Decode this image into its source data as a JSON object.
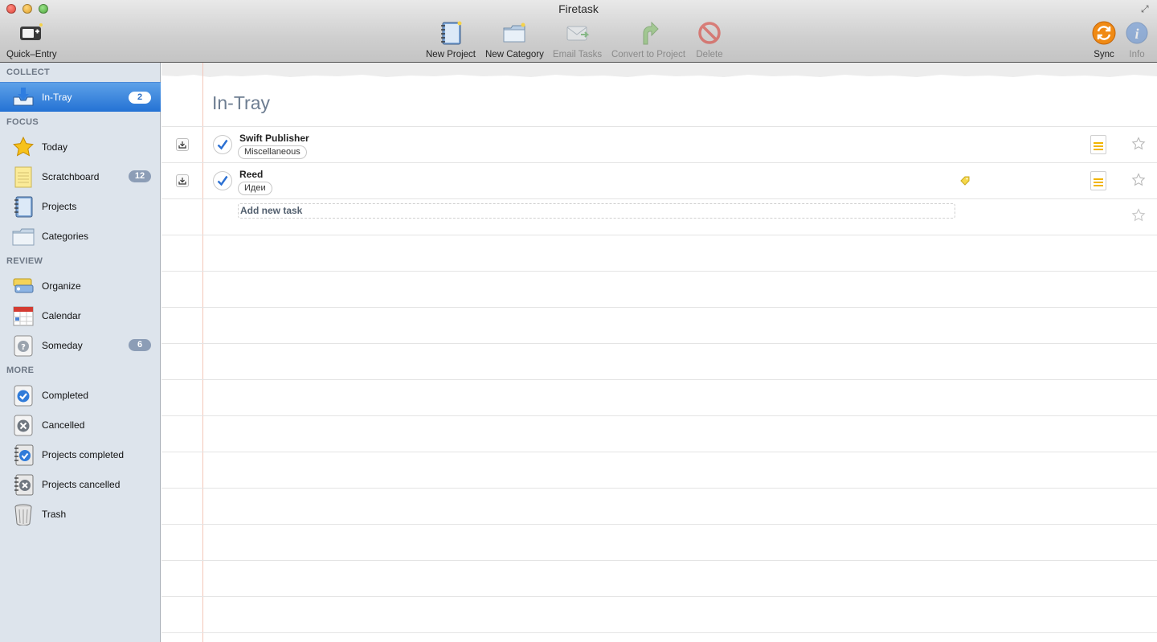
{
  "window": {
    "title": "Firetask"
  },
  "toolbar": {
    "quick_entry": "Quick–Entry",
    "new_project": "New Project",
    "new_category": "New Category",
    "email_tasks": "Email Tasks",
    "convert_to_project": "Convert to Project",
    "delete": "Delete",
    "sync": "Sync",
    "info": "Info"
  },
  "sidebar": {
    "sections": {
      "collect": "COLLECT",
      "focus": "FOCUS",
      "review": "REVIEW",
      "more": "MORE"
    },
    "items": [
      {
        "label": "In-Tray",
        "badge": "2",
        "icon": "in-tray-icon",
        "selected": true
      },
      {
        "label": "Today",
        "icon": "star-icon"
      },
      {
        "label": "Scratchboard",
        "badge": "12",
        "icon": "notepad-icon"
      },
      {
        "label": "Projects",
        "icon": "notebook-icon"
      },
      {
        "label": "Categories",
        "icon": "folder-icon"
      },
      {
        "label": "Organize",
        "icon": "organize-icon"
      },
      {
        "label": "Calendar",
        "icon": "calendar-icon"
      },
      {
        "label": "Someday",
        "badge": "6",
        "icon": "question-icon"
      },
      {
        "label": "Completed",
        "icon": "checkbox-icon"
      },
      {
        "label": "Cancelled",
        "icon": "cancel-icon"
      },
      {
        "label": "Projects completed",
        "icon": "project-check-icon"
      },
      {
        "label": "Projects cancelled",
        "icon": "project-cancel-icon"
      },
      {
        "label": "Trash",
        "icon": "trash-icon"
      }
    ]
  },
  "main": {
    "title": "In-Tray",
    "tasks": [
      {
        "name": "Swift Publisher",
        "category": "Miscellaneous",
        "has_tag": false
      },
      {
        "name": "Reed",
        "category": "Идеи",
        "has_tag": true
      }
    ],
    "add_task_label": "Add new task"
  },
  "colors": {
    "selection": "#2f7bd9",
    "badge": "#8c9db6",
    "note_lines": "#f2b500",
    "sync": "#f08a14",
    "info": "#5d8fd6"
  }
}
